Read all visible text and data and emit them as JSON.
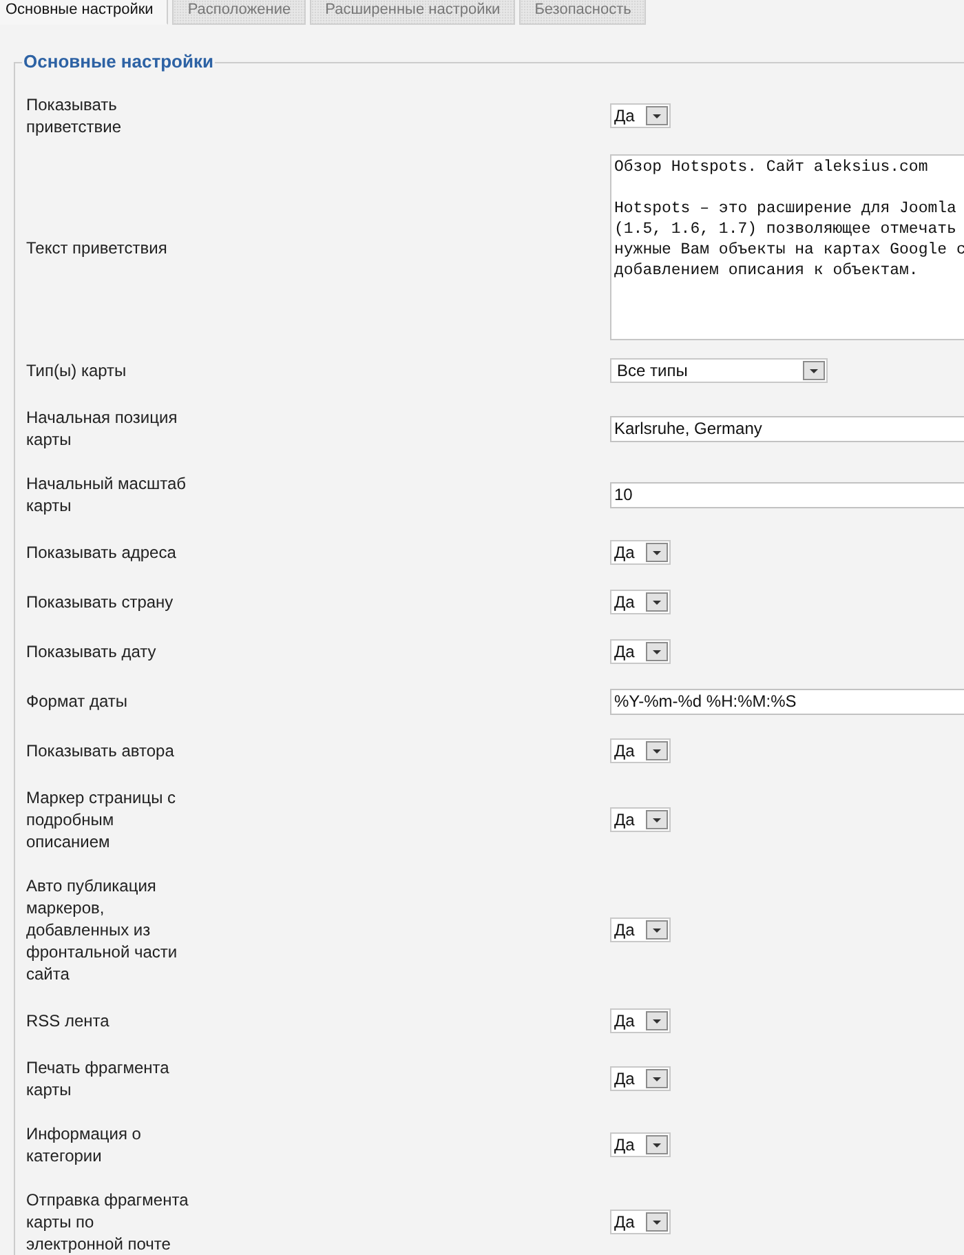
{
  "tabs": [
    {
      "label": "Основные настройки",
      "selected": true
    },
    {
      "label": "Расположение",
      "selected": false
    },
    {
      "label": "Расширенные настройки",
      "selected": false
    },
    {
      "label": "Безопасность",
      "selected": false
    }
  ],
  "section": {
    "legend": "Основные настройки"
  },
  "rows": [
    {
      "label": "Показывать приветствие",
      "kind": "yesno",
      "value": "Да"
    },
    {
      "label": "Текст приветствия",
      "kind": "textarea",
      "value": "Обзор Hotspots. Сайт aleksius.com\n\nHotspots – это расширение для Joomla\n(1.5, 1.6, 1.7) позволяющее отмечать\nнужные Вам объекты на картах Google с\nдобавлением описания к объектам."
    },
    {
      "label": "Тип(ы) карты",
      "kind": "select",
      "value": "Все типы"
    },
    {
      "label": "Начальная позиция карты",
      "kind": "text",
      "value": "Karlsruhe, Germany"
    },
    {
      "label": "Начальный масштаб карты",
      "kind": "text",
      "value": "10"
    },
    {
      "label": "Показывать адреса",
      "kind": "yesno",
      "value": "Да"
    },
    {
      "label": "Показывать страну",
      "kind": "yesno",
      "value": "Да"
    },
    {
      "label": "Показывать дату",
      "kind": "yesno",
      "value": "Да"
    },
    {
      "label": "Формат даты",
      "kind": "text",
      "value": "%Y-%m-%d %H:%M:%S"
    },
    {
      "label": "Показывать автора",
      "kind": "yesno",
      "value": "Да"
    },
    {
      "label": "Маркер страницы с подробным описанием",
      "kind": "yesno",
      "value": "Да"
    },
    {
      "label": "Авто публикация маркеров, добавленных из фронтальной части сайта",
      "kind": "yesno",
      "value": "Да"
    },
    {
      "label": "RSS лента",
      "kind": "yesno",
      "value": "Да"
    },
    {
      "label": "Печать фрагмента карты",
      "kind": "yesno",
      "value": "Да"
    },
    {
      "label": "Информация о категории",
      "kind": "yesno",
      "value": "Да"
    },
    {
      "label": "Отправка фрагмента карты по электронной почте",
      "kind": "yesno",
      "value": "Да"
    }
  ]
}
